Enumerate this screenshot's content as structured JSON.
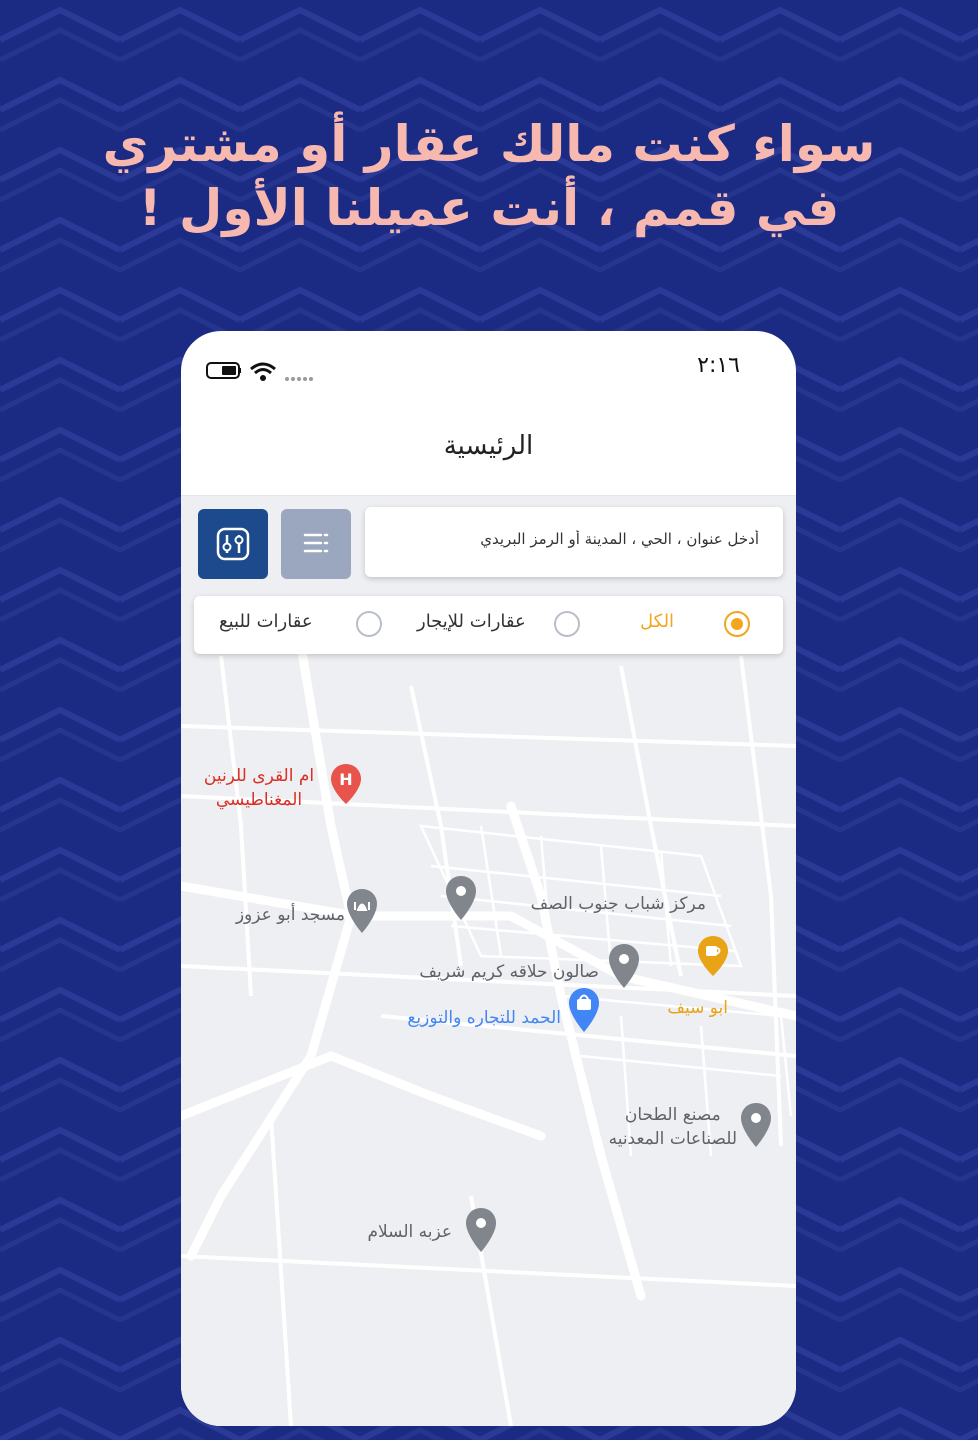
{
  "headline": {
    "line1": "سواء كنت مالك عقار أو مشتري",
    "line2": "في قمم ، أنت عميلنا الأول !"
  },
  "status_bar": {
    "time": "٢:١٦"
  },
  "app_bar": {
    "title": "الرئيسية"
  },
  "search": {
    "placeholder": "أدخل عنوان ، الحي ، المدينة أو الرمز البريدي"
  },
  "toolbar": {
    "list_icon": "list-icon",
    "filter_icon": "sliders-icon"
  },
  "filter": {
    "options": [
      {
        "label": "الكل",
        "selected": true
      },
      {
        "label": "عقارات للإيجار",
        "selected": false
      },
      {
        "label": "عقارات للبيع",
        "selected": false
      }
    ],
    "accent_color": "#f4a51c"
  },
  "map": {
    "pois": [
      {
        "name": "ام القرى للرنين",
        "name2": "المغناطيسي",
        "icon": "hospital-icon",
        "color": "#d93025"
      },
      {
        "name": "مسجد أبو عزوز",
        "icon": "mosque-icon",
        "color": "#5f6368"
      },
      {
        "name": "مركز شباب جنوب الصف",
        "icon": "place-icon",
        "color": "#5f6368"
      },
      {
        "name": "صالون حلاقه كريم شريف",
        "icon": "place-icon",
        "color": "#5f6368"
      },
      {
        "name": "ابو سيف",
        "icon": "cafe-icon",
        "color": "#e8a317"
      },
      {
        "name": "الحمد للتجاره والتوزيع",
        "icon": "shopping-icon",
        "color": "#4285f4"
      },
      {
        "name": "مصنع الطحان",
        "name2": "للصناعات المعدنيه",
        "icon": "place-icon",
        "color": "#5f6368"
      },
      {
        "name": "عزبه السلام",
        "icon": "place-icon",
        "color": "#5f6368"
      }
    ]
  },
  "colors": {
    "background": "#1b2a82",
    "headline": "#f7b8b0",
    "primary_button": "#1d4a8c"
  }
}
